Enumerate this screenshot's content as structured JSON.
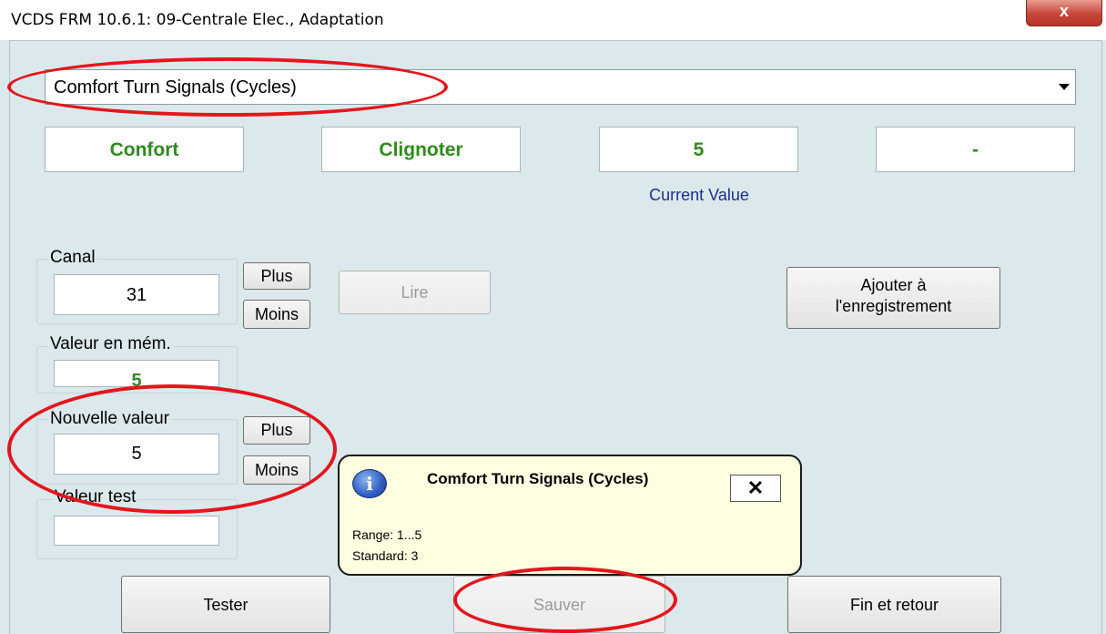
{
  "window": {
    "title": "VCDS FRM 10.6.1: 09-Centrale Elec.,  Adaptation",
    "close_label": "x"
  },
  "channel_select": {
    "value": "Comfort Turn Signals (Cycles)"
  },
  "values": {
    "box1": "Confort",
    "box2": "Clignoter",
    "box3": "5",
    "box4": "-",
    "current_label": "Current Value"
  },
  "canal": {
    "label": "Canal",
    "value": "31",
    "plus": "Plus",
    "minus": "Moins"
  },
  "read_button": "Lire",
  "add_button": {
    "line1": "Ajouter à",
    "line2": "l'enregistrement"
  },
  "stored": {
    "label": "Valeur en mém.",
    "value": "5"
  },
  "new_value": {
    "label": "Nouvelle valeur",
    "value": "5",
    "plus": "Plus",
    "minus": "Moins"
  },
  "test_value": {
    "label": "Valeur test",
    "value": ""
  },
  "tooltip": {
    "icon": "i",
    "title": "Comfort Turn Signals (Cycles)",
    "close": "✕",
    "range": "Range: 1...5",
    "standard": "Standard: 3"
  },
  "buttons": {
    "test": "Tester",
    "save": "Sauver",
    "exit": "Fin et retour"
  },
  "colors": {
    "background": "#dbe8ec",
    "value_green": "#2e8b1e",
    "current_value_blue": "#1f2f8c",
    "highlight_red": "#e3161c"
  }
}
